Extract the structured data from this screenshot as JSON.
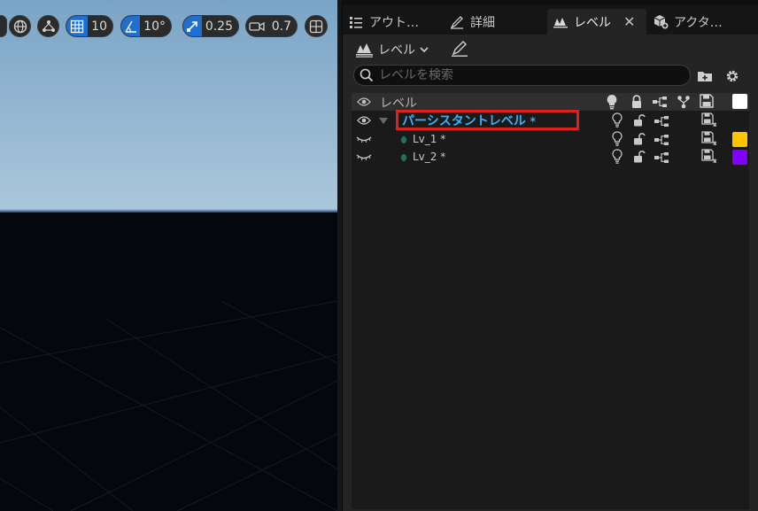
{
  "viewport": {
    "grid_snap_value": "10",
    "rotation_snap_value": "10°",
    "scale_snap_value": "0.25",
    "camera_speed_value": "0.7"
  },
  "tabs": [
    {
      "label": "アウト…",
      "icon": "outliner-icon"
    },
    {
      "label": "詳細",
      "icon": "details-icon"
    },
    {
      "label": "レベル",
      "icon": "levels-icon",
      "active": true
    },
    {
      "label": "アクタ…",
      "icon": "actor-icon"
    }
  ],
  "toolbar": {
    "levels_button_label": "レベル"
  },
  "search": {
    "placeholder": "レベルを検索",
    "value": ""
  },
  "list": {
    "header_label": "レベル",
    "rows": [
      {
        "name": "パーシスタントレベル",
        "dirty": "*",
        "color": "#ffffff"
      },
      {
        "name": "Lv_1",
        "dirty": "*",
        "color": "#ffc400"
      },
      {
        "name": "Lv_2",
        "dirty": "*",
        "color": "#8000ff"
      }
    ]
  },
  "colors": {
    "accent_blue": "#1f6fd1",
    "persistent_level_text": "#36b4ff",
    "highlight_box": "#e0201f"
  }
}
